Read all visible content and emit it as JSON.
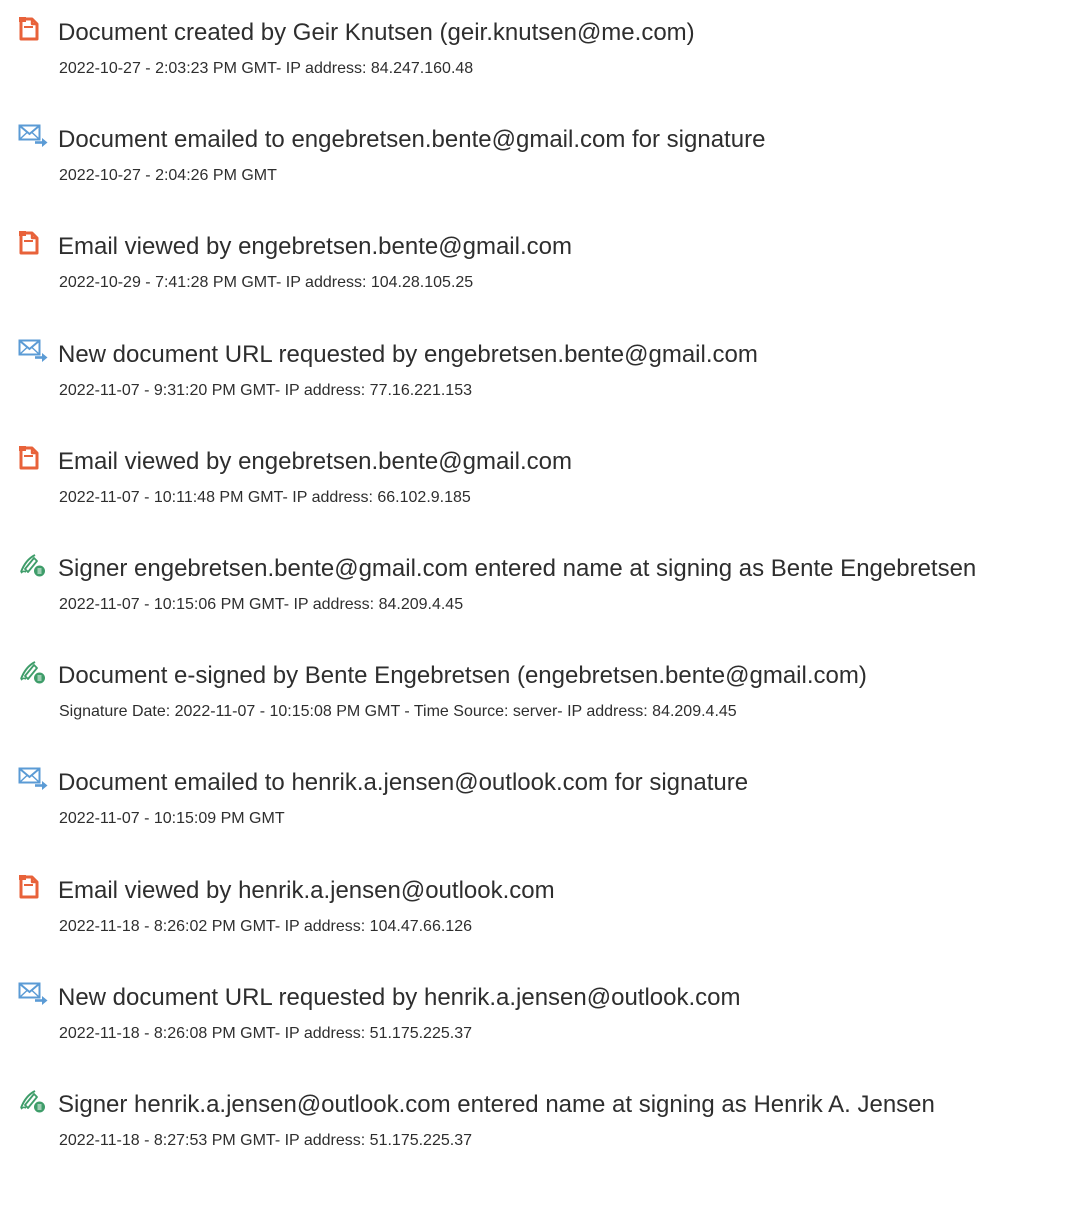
{
  "events": [
    {
      "icon": "document-icon",
      "title": "Document created by Geir Knutsen (geir.knutsen@me.com)",
      "detail": "2022-10-27 - 2:03:23 PM GMT- IP address: 84.247.160.48"
    },
    {
      "icon": "email-icon",
      "title": "Document emailed to engebretsen.bente@gmail.com for signature",
      "detail": "2022-10-27 - 2:04:26 PM GMT"
    },
    {
      "icon": "document-icon",
      "title": "Email viewed by engebretsen.bente@gmail.com",
      "detail": "2022-10-29 - 7:41:28 PM GMT- IP address: 104.28.105.25"
    },
    {
      "icon": "email-icon",
      "title": "New document URL requested by engebretsen.bente@gmail.com",
      "detail": "2022-11-07 - 9:31:20 PM GMT- IP address: 77.16.221.153"
    },
    {
      "icon": "document-icon",
      "title": "Email viewed by engebretsen.bente@gmail.com",
      "detail": "2022-11-07 - 10:11:48 PM GMT- IP address: 66.102.9.185"
    },
    {
      "icon": "signature-pen-icon",
      "title": "Signer engebretsen.bente@gmail.com entered name at signing as Bente Engebretsen",
      "detail": "2022-11-07 - 10:15:06 PM GMT- IP address: 84.209.4.45"
    },
    {
      "icon": "signature-pen-icon",
      "title": "Document e-signed by Bente Engebretsen (engebretsen.bente@gmail.com)",
      "detail": "Signature Date: 2022-11-07 - 10:15:08 PM GMT - Time Source: server- IP address: 84.209.4.45"
    },
    {
      "icon": "email-icon",
      "title": "Document emailed to henrik.a.jensen@outlook.com for signature",
      "detail": "2022-11-07 - 10:15:09 PM GMT"
    },
    {
      "icon": "document-icon",
      "title": "Email viewed by henrik.a.jensen@outlook.com",
      "detail": "2022-11-18 - 8:26:02 PM GMT- IP address: 104.47.66.126"
    },
    {
      "icon": "email-icon",
      "title": "New document URL requested by henrik.a.jensen@outlook.com",
      "detail": "2022-11-18 - 8:26:08 PM GMT- IP address: 51.175.225.37"
    },
    {
      "icon": "signature-pen-icon",
      "title": "Signer henrik.a.jensen@outlook.com entered name at signing as Henrik A. Jensen",
      "detail": "2022-11-18 - 8:27:53 PM GMT- IP address: 51.175.225.37"
    }
  ],
  "colors": {
    "document_icon": "#e8623a",
    "email_icon": "#5b9bd5",
    "signature_icon": "#3f9d6a",
    "text": "#2e2e2e"
  }
}
